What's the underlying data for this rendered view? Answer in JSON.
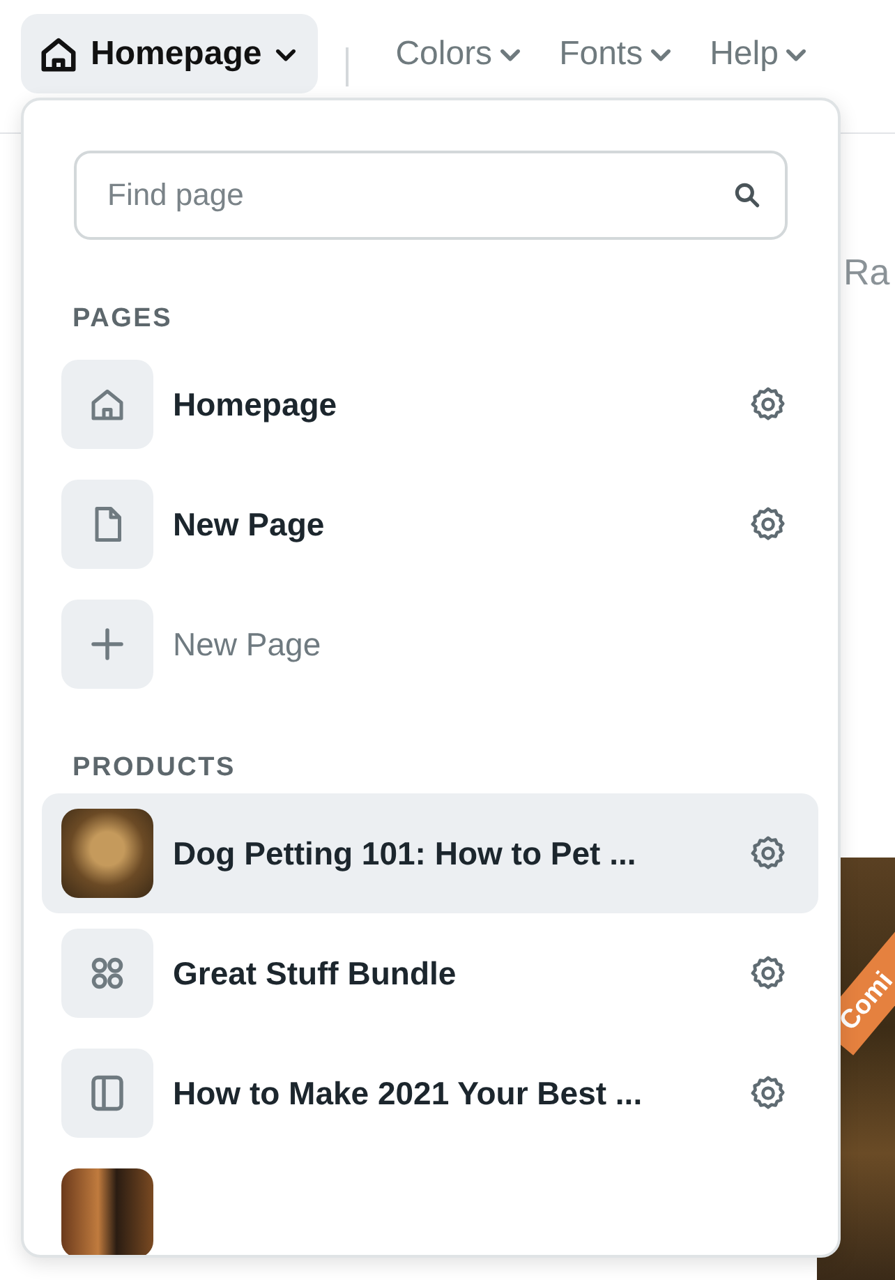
{
  "topbar": {
    "current": {
      "label": "Homepage",
      "selected": true
    },
    "menus": [
      {
        "label": "Colors"
      },
      {
        "label": "Fonts"
      },
      {
        "label": "Help"
      }
    ]
  },
  "page": {
    "heading": "Ra",
    "ribbon": "Comi"
  },
  "dropdown": {
    "search": {
      "placeholder": "Find page"
    },
    "sections": [
      {
        "title": "PAGES",
        "items": [
          {
            "kind": "home",
            "title": "Homepage",
            "settings": true,
            "selected": false
          },
          {
            "kind": "page",
            "title": "New Page",
            "settings": true,
            "selected": false
          },
          {
            "kind": "add",
            "title": "New Page",
            "settings": false,
            "selected": false
          }
        ]
      },
      {
        "title": "PRODUCTS",
        "items": [
          {
            "kind": "photo",
            "title": "Dog Petting 101: How to Pet ...",
            "settings": true,
            "selected": true
          },
          {
            "kind": "bundle",
            "title": "Great Stuff Bundle",
            "settings": true,
            "selected": false
          },
          {
            "kind": "course",
            "title": "How to Make 2021 Your Best ...",
            "settings": true,
            "selected": false
          },
          {
            "kind": "photo2",
            "settings": false,
            "selected": false
          }
        ]
      }
    ]
  }
}
